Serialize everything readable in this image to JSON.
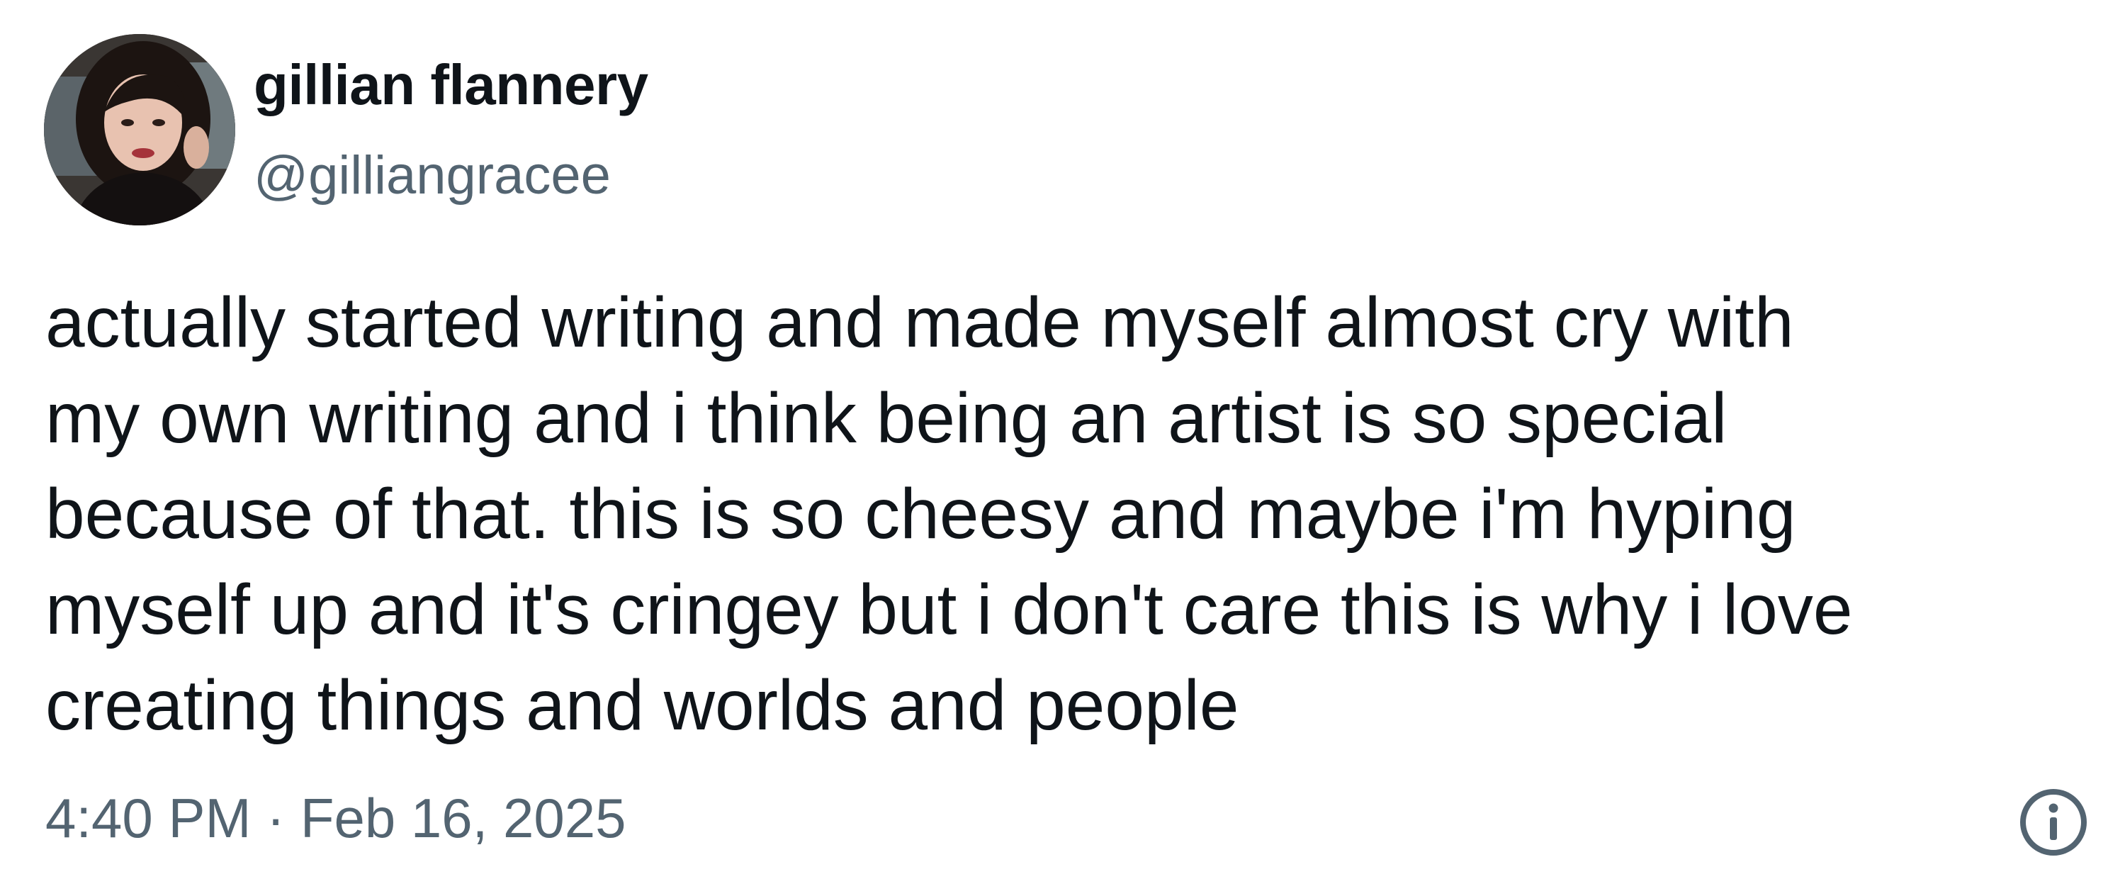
{
  "tweet": {
    "author": {
      "display_name": "gillian flannery",
      "handle": "@gilliangracee",
      "avatar_icon": "profile-photo"
    },
    "text_lines": [
      "actually started writing and made myself almost cry with",
      "my own writing and i think being an artist is so special",
      "because of that. this is so cheesy and maybe i'm hyping",
      "myself up and it's cringey but i don't care this is why i love",
      "creating things and worlds and people"
    ],
    "time": "4:40 PM",
    "separator": " · ",
    "date": "Feb 16, 2025",
    "info_icon": "info-circle-icon"
  },
  "colors": {
    "text_primary": "#0f1419",
    "text_secondary": "#536471",
    "background": "#ffffff"
  }
}
